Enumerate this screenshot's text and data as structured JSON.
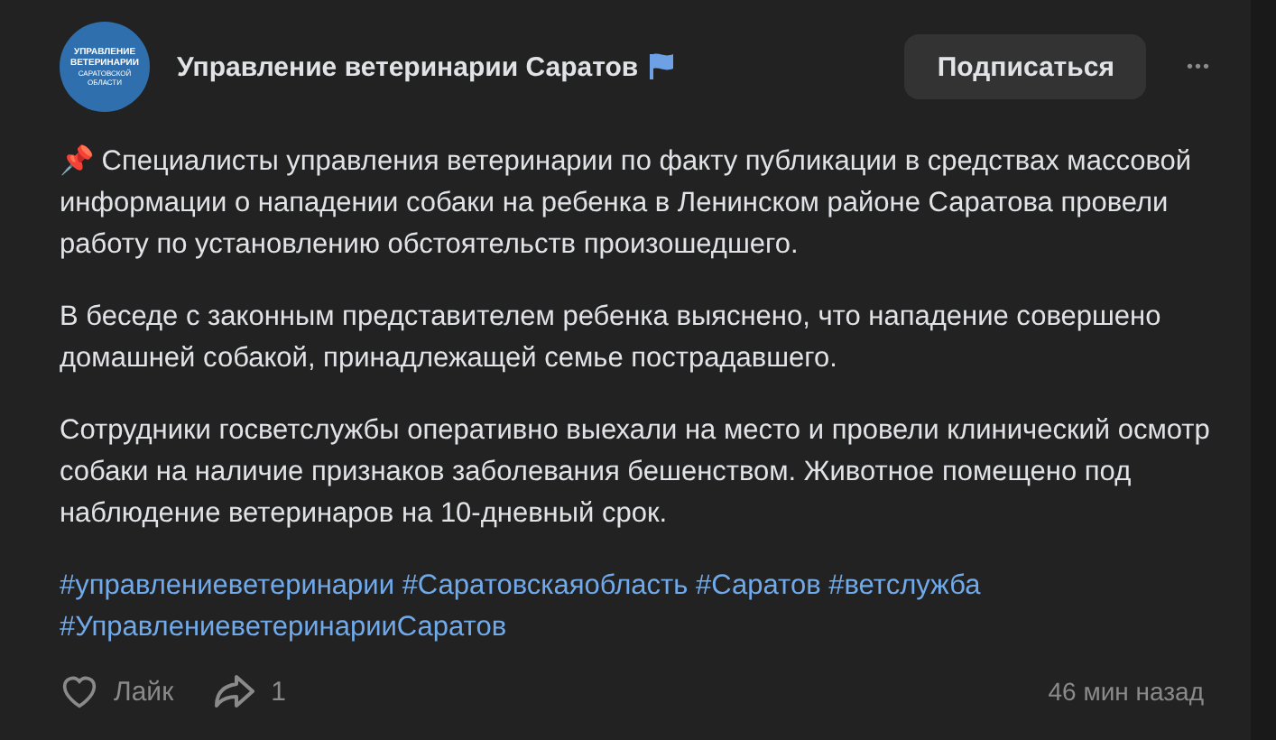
{
  "post": {
    "author": {
      "name": "Управление ветеринарии Саратов",
      "avatar_lines": [
        "УПРАВЛЕНИЕ",
        "ВЕТЕРИНАРИИ",
        "САРАТОВСКОЙ",
        "ОБЛАСТИ"
      ],
      "verified_flag": true
    },
    "subscribe_button": "Подписаться",
    "more_button": "•••",
    "paragraphs": [
      "📌 Специалисты управления ветеринарии по факту публикации в средствах массовой информации о нападении собаки на ребенка в Ленинском районе Саратова провели работу по установлению обстоятельств произошедшего.",
      "В беседе с законным представителем ребенка выяснено, что нападение совершено домашней собакой, принадлежащей семье пострадавшего.",
      "Сотрудники госветслужбы оперативно выехали на место и провели клинический осмотр собаки на наличие признаков заболевания бешенством. Животное помещено под наблюдение ветеринаров на 10-дневный срок."
    ],
    "hashtags": [
      "#управлениеветеринарии",
      "#Саратовскаяобласть",
      "#Саратов",
      "#ветслужба",
      "#УправлениеветеринарииСаратов"
    ],
    "like": {
      "label": "Лайк",
      "liked": false
    },
    "share": {
      "count": "1"
    },
    "time": "46 мин назад"
  }
}
